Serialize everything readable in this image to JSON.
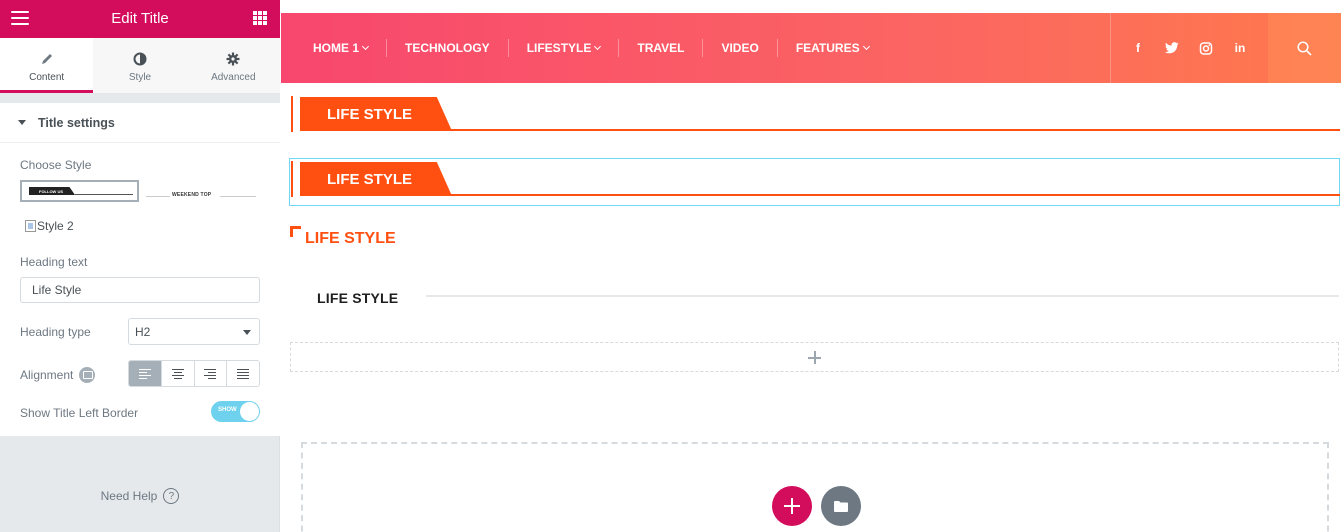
{
  "panel": {
    "title": "Edit Title",
    "tabs": [
      {
        "label": "Content",
        "icon": "pencil-icon",
        "active": true
      },
      {
        "label": "Style",
        "icon": "contrast-icon",
        "active": false
      },
      {
        "label": "Advanced",
        "icon": "gear-icon",
        "active": false
      }
    ],
    "section_title": "Title settings",
    "choose_style_label": "Choose Style",
    "style_thumb_1_text": "FOLLOW US",
    "style_thumb_2_text": "WEEKEND TOP",
    "style2_alt": "Style 2",
    "heading_text_label": "Heading text",
    "heading_text_value": "Life Style",
    "heading_type_label": "Heading type",
    "heading_type_value": "H2",
    "alignment_label": "Alignment",
    "alignment_options": [
      "left",
      "center",
      "right",
      "justify"
    ],
    "alignment_selected": "left",
    "show_border_label": "Show Title Left Border",
    "show_border_toggle": "SHOW",
    "show_border_on": true,
    "need_help": "Need Help",
    "accent_color": "#d30c5c"
  },
  "preview": {
    "nav": {
      "items": [
        {
          "label": "HOME 1",
          "dropdown": true
        },
        {
          "label": "TECHNOLOGY",
          "dropdown": false
        },
        {
          "label": "LIFESTYLE",
          "dropdown": true
        },
        {
          "label": "TRAVEL",
          "dropdown": false
        },
        {
          "label": "VIDEO",
          "dropdown": false
        },
        {
          "label": "FEATURES",
          "dropdown": true
        }
      ],
      "social": [
        "f",
        "twitter",
        "instagram",
        "in"
      ],
      "social_text": {
        "facebook": "f",
        "linkedin": "in"
      }
    },
    "titles": {
      "block1": "LIFE STYLE",
      "block2": "LIFE STYLE",
      "block3": "LIFE STYLE",
      "block4": "LIFE STYLE"
    },
    "title_color": "#ff4f11"
  }
}
